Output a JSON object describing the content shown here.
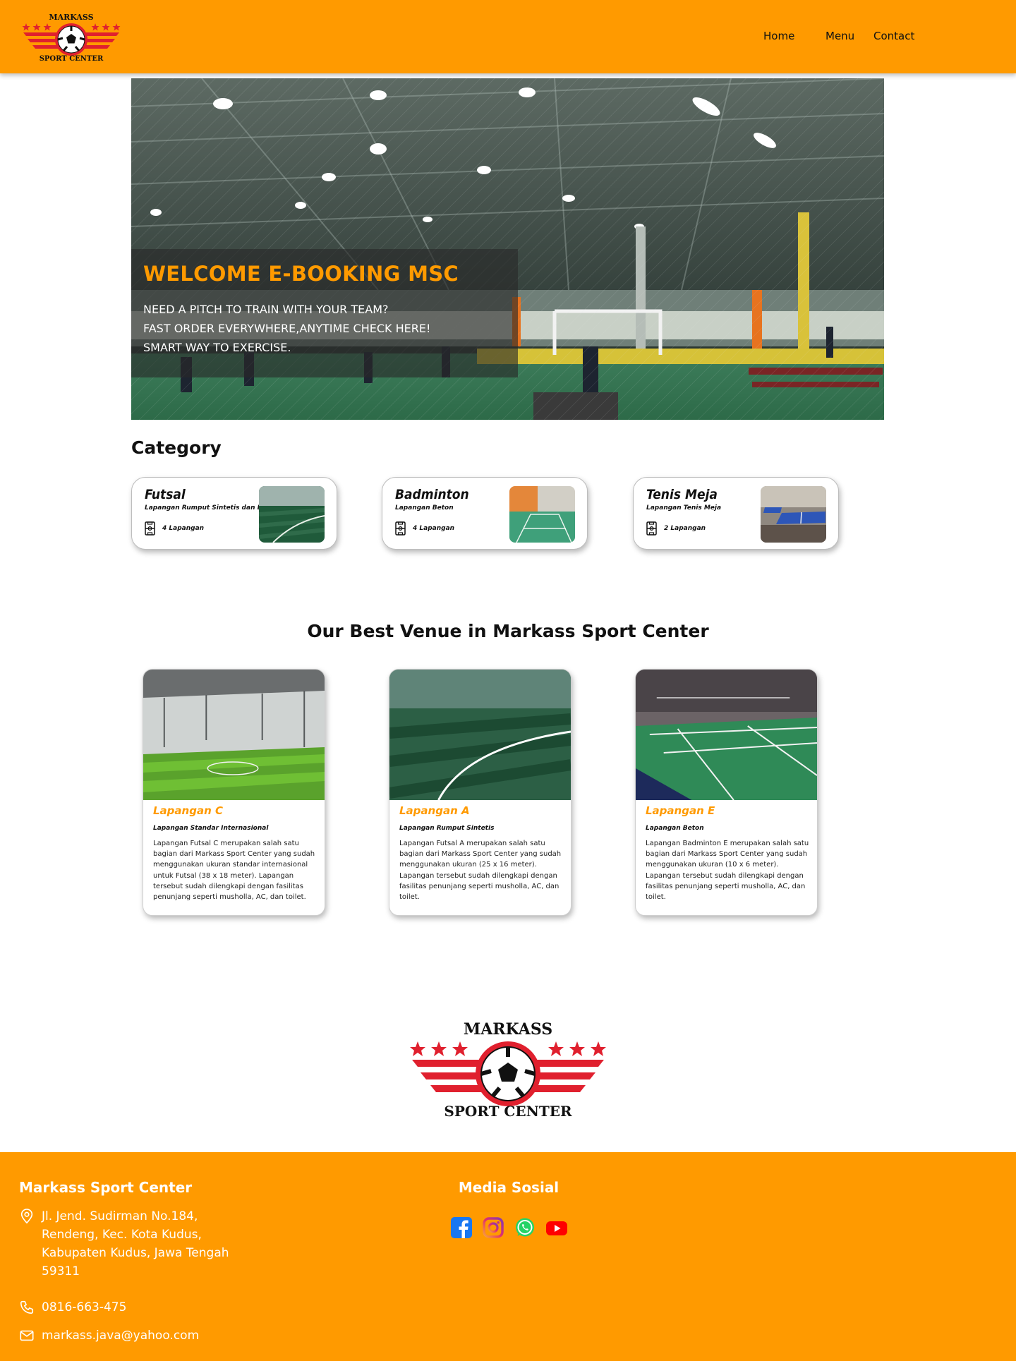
{
  "brand": {
    "logo_top_text": "MARKASS",
    "logo_bottom_text": "SPORT CENTER"
  },
  "nav": {
    "home": "Home",
    "menu": "Menu",
    "contact": "Contact"
  },
  "hero": {
    "title": "WELCOME E-BOOKING MSC",
    "lines": [
      "NEED A PITCH TO TRAIN WITH YOUR TEAM?",
      "FAST ORDER EVERYWHERE,ANYTIME CHECK HERE!",
      "SMART WAY TO EXERCISE."
    ]
  },
  "category": {
    "title": "Category",
    "items": [
      {
        "name": "Futsal",
        "subtitle": "Lapangan Rumput Sintetis dan Beton",
        "count": "4 Lapangan"
      },
      {
        "name": "Badminton",
        "subtitle": "Lapangan Beton",
        "count": "4 Lapangan"
      },
      {
        "name": "Tenis Meja",
        "subtitle": "Lapangan Tenis Meja",
        "count": "2 Lapangan"
      }
    ]
  },
  "venues": {
    "title": "Our Best Venue in Markass Sport Center",
    "items": [
      {
        "name": "Lapangan C",
        "subtitle": "Lapangan Standar Internasional",
        "description": "Lapangan Futsal C merupakan salah satu bagian dari Markass Sport Center yang sudah menggunakan ukuran standar internasional untuk Futsal (38 x 18 meter). Lapangan tersebut sudah dilengkapi dengan fasilitas penunjang seperti musholla, AC, dan toilet."
      },
      {
        "name": "Lapangan A",
        "subtitle": "Lapangan Rumput Sintetis",
        "description": "Lapangan Futsal A merupakan salah satu bagian dari Markass Sport Center yang sudah menggunakan ukuran (25 x 16 meter). Lapangan tersebut sudah dilengkapi dengan fasilitas penunjang seperti musholla, AC, dan toilet."
      },
      {
        "name": "Lapangan E",
        "subtitle": "Lapangan Beton",
        "description": "Lapangan Badminton E merupakan salah satu bagian dari Markass Sport Center yang sudah menggunakan ukuran (10 x 6 meter). Lapangan tersebut sudah dilengkapi dengan fasilitas penunjang seperti musholla, AC, dan toilet."
      }
    ]
  },
  "footer": {
    "title": "Markass Sport Center",
    "address": "Jl. Jend. Sudirman No.184, Rendeng, Kec. Kota Kudus, Kabupaten Kudus, Jawa Tengah 59311",
    "phone": "0816-663-475",
    "email": "markass.java@yahoo.com",
    "social_title": "Media Sosial",
    "social_icons": [
      "facebook-icon",
      "instagram-icon",
      "whatsapp-icon",
      "youtube-icon"
    ]
  },
  "colors": {
    "brand_orange": "#ff9a00",
    "logo_red": "#e0202e"
  }
}
